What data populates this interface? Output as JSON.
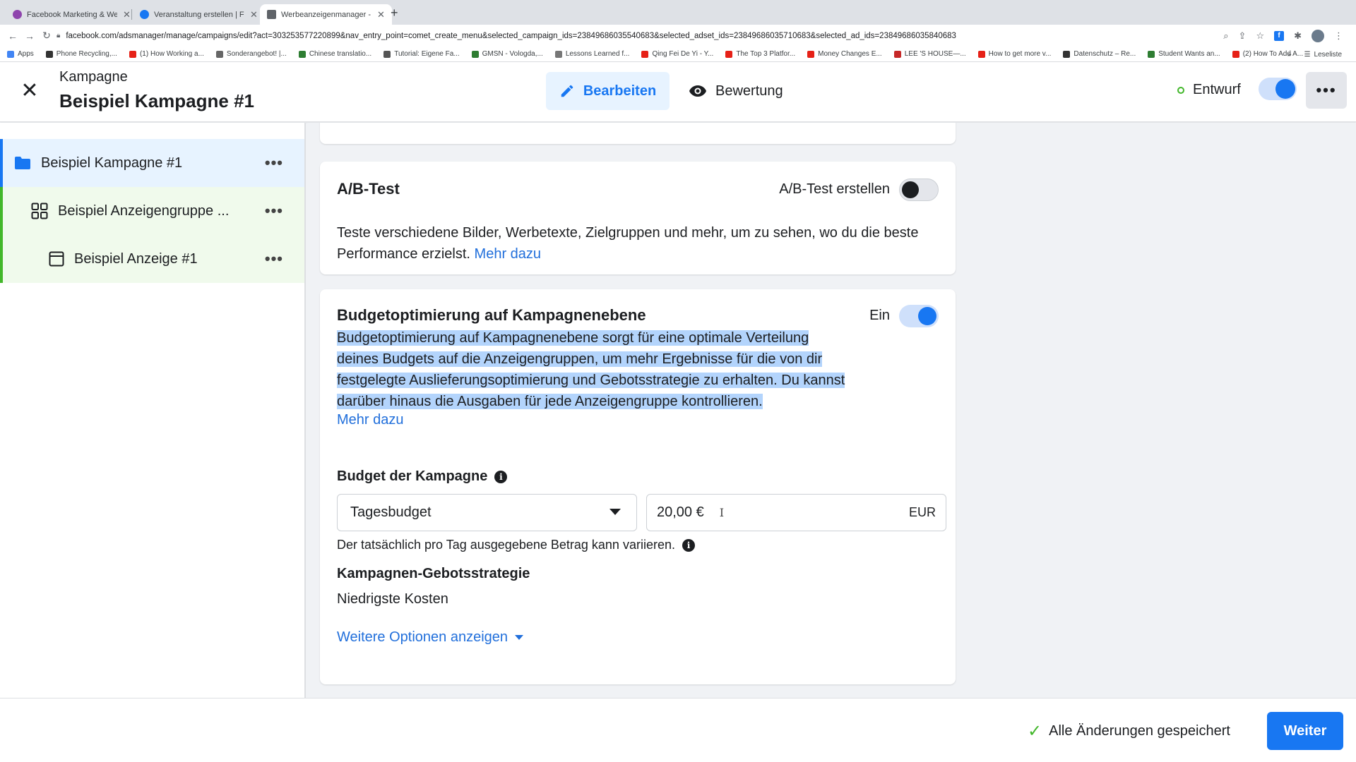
{
  "browser": {
    "tabs": [
      {
        "label": "Facebook Marketing & Werbe…",
        "color": "#8e44ad"
      },
      {
        "label": "Veranstaltung erstellen | Faceb…",
        "color": "#1877f2"
      },
      {
        "label": "Werbeanzeigenmanager - Wer…",
        "color": "#5f6368"
      }
    ],
    "url": "facebook.com/adsmanager/manage/campaigns/edit?act=303253577220899&nav_entry_point=comet_create_menu&selected_campaign_ids=23849686035540683&selected_adset_ids=23849686035710683&selected_ad_ids=23849686035840683",
    "bookmarks": [
      {
        "label": "Apps",
        "color": "#4285f4"
      },
      {
        "label": "Phone Recycling,...",
        "color": "#333333"
      },
      {
        "label": "(1) How Working a...",
        "color": "#e62117"
      },
      {
        "label": "Sonderangebot! |...",
        "color": "#666666"
      },
      {
        "label": "Chinese translatio...",
        "color": "#2e7d32"
      },
      {
        "label": "Tutorial: Eigene Fa...",
        "color": "#555555"
      },
      {
        "label": "GMSN - Vologda,...",
        "color": "#2e7d32"
      },
      {
        "label": "Lessons Learned f...",
        "color": "#777777"
      },
      {
        "label": "Qing Fei De Yi - Y...",
        "color": "#e62117"
      },
      {
        "label": "The Top 3 Platfor...",
        "color": "#e62117"
      },
      {
        "label": "Money Changes E...",
        "color": "#e62117"
      },
      {
        "label": "LEE 'S HOUSE—...",
        "color": "#c62828"
      },
      {
        "label": "How to get more v...",
        "color": "#e62117"
      },
      {
        "label": "Datenschutz – Re...",
        "color": "#333333"
      },
      {
        "label": "Student Wants an...",
        "color": "#2e7d32"
      },
      {
        "label": "(2) How To Add A...",
        "color": "#e62117"
      }
    ],
    "bookmarks_more": "»",
    "reading_list": "Leseliste"
  },
  "header": {
    "subtitle": "Kampagne",
    "title": "Beispiel Kampagne #1",
    "edit_label": "Bearbeiten",
    "review_label": "Bewertung",
    "status_label": "Entwurf",
    "draft_toggle_on": true,
    "more_label": "•••"
  },
  "sidebar": {
    "campaign": {
      "label": "Beispiel Kampagne #1",
      "more": "•••"
    },
    "adset": {
      "label": "Beispiel Anzeigengruppe ...",
      "more": "•••"
    },
    "ad": {
      "label": "Beispiel Anzeige #1",
      "more": "•••"
    }
  },
  "ab_test": {
    "title": "A/B-Test",
    "toggle_label": "A/B-Test erstellen",
    "toggle_on": false,
    "description": "Teste verschiedene Bilder, Werbetexte, Zielgruppen und mehr, um zu sehen, wo du die beste Performance erzielst.",
    "link": "Mehr dazu"
  },
  "cbo": {
    "title": "Budgetoptimierung auf Kampagnenebene",
    "toggle_label": "Ein",
    "toggle_on": true,
    "description": "Budgetoptimierung auf Kampagnenebene sorgt für eine optimale Verteilung deines Budgets auf die Anzeigengruppen, um mehr Ergebnisse für die von dir festgelegte Auslieferungsoptimierung und Gebotsstrategie zu erhalten. Du kannst darüber hinaus die Ausgaben für jede Anzeigengruppe kontrollieren.",
    "link": "Mehr dazu",
    "budget_label": "Budget der Kampagne",
    "budget_type": "Tagesbudget",
    "amount": "20,00 €",
    "currency": "EUR",
    "budget_note": "Der tatsächlich pro Tag ausgegebene Betrag kann variieren.",
    "strategy_label": "Kampagnen-Gebotsstrategie",
    "strategy_value": "Niedrigste Kosten",
    "more_options": "Weitere Optionen anzeigen"
  },
  "footer": {
    "saved_label": "Alle Änderungen gespeichert",
    "next_label": "Weiter"
  },
  "colors": {
    "accent": "#1877f2",
    "link": "#216fdb",
    "success": "#42b72a",
    "selection": "#b3d4fc"
  }
}
